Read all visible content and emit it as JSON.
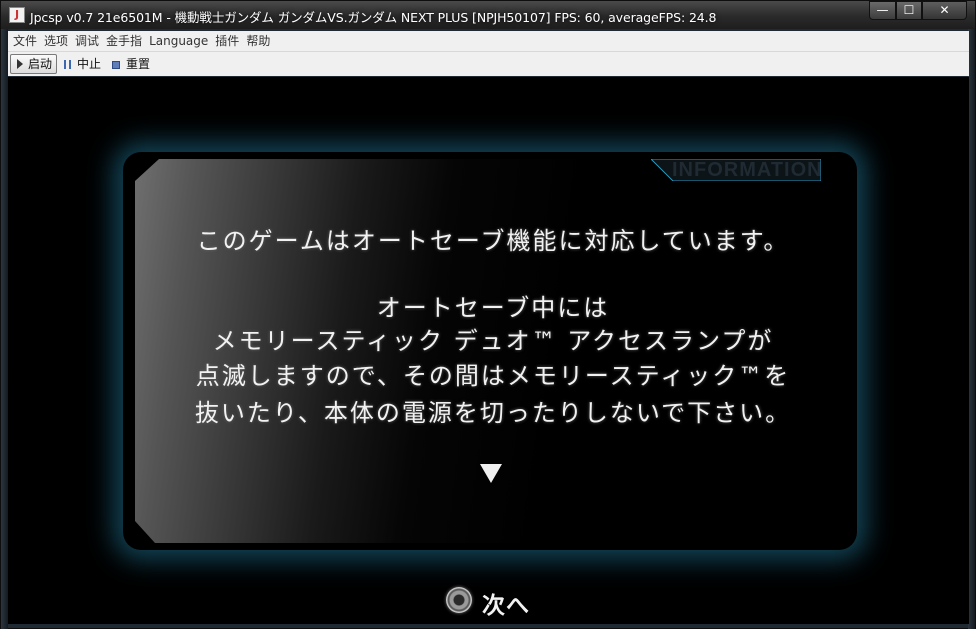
{
  "window": {
    "title": "Jpcsp v0.7 21e6501M - 機動戦士ガンダム ガンダムVS.ガンダム NEXT PLUS [NPJH50107] FPS: 60, averageFPS: 24.8",
    "controls": {
      "minimize": "—",
      "maximize": "☐",
      "close": "✕"
    }
  },
  "menubar": {
    "items": [
      {
        "label": "文件"
      },
      {
        "label": "选项"
      },
      {
        "label": "调试"
      },
      {
        "label": "金手指"
      },
      {
        "label": "Language"
      },
      {
        "label": "插件"
      },
      {
        "label": "帮助"
      }
    ]
  },
  "toolbar": {
    "run_label": "启动",
    "pause_label": "中止",
    "reset_label": "重置"
  },
  "game": {
    "header": "INFORMATION",
    "lines": [
      "このゲームはオートセーブ機能に対応しています。",
      "オートセーブ中には",
      "メモリースティック デュオ™ アクセスランプが",
      "点滅しますので、その間はメモリースティック™を",
      "抜いたり、本体の電源を切ったりしないで下さい。"
    ],
    "next_label": "次へ",
    "accent_color": "#2c96be"
  }
}
